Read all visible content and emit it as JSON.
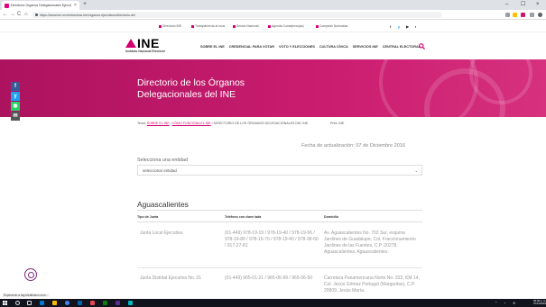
{
  "browser": {
    "tab_title": "Directorio Órganos Delegacionales Ejecut",
    "tab_close": "×",
    "new_tab": "+",
    "window_controls": [
      "–",
      "☐",
      "×"
    ],
    "back": "←",
    "forward": "→",
    "reload": "C",
    "home": "⌂",
    "url": "https://www.ine.mx/estructura-ine/organos-ejecutivos/directorio-del"
  },
  "utility_links": [
    "Directorio INE",
    "Transparencia al ecus",
    "Sesión Nacional",
    "Agenda Consejeros(as)",
    "Compartir Normativa"
  ],
  "social": [
    "f",
    "y",
    "▶",
    "◑"
  ],
  "header": {
    "logo_text": "INE",
    "logo_subtitle": "Instituto Nacional Electoral",
    "nav": [
      "SOBRE EL INE",
      "CREDENCIAL PARA VOTAR",
      "VOTO Y ELECCIONES",
      "CULTURA CÍVICA",
      "SERVICIOS INE",
      "CENTRAL ELECTORAL"
    ],
    "search_icon": "search-icon"
  },
  "hero": {
    "title_line1": "Directorio de los Órganos",
    "title_line2": "Delegacionales del INE"
  },
  "share": [
    {
      "label": "f",
      "color": "#3b5998"
    },
    {
      "label": "y",
      "color": "#1da1f2"
    },
    {
      "label": "◉",
      "color": "#25d366"
    },
    {
      "label": "✉",
      "color": "#555555"
    }
  ],
  "breadcrumb": {
    "prefix": "Tema:",
    "crumb1": "SOBRE EL INE",
    "sep1": " / ",
    "crumb2": "CÓMO FUNCIONA EL INE",
    "sep2": " / ",
    "current": "DIRECTORIO DE LOS ÓRGANOS DELEGACIONALES DEL INE",
    "print": "Print: INE"
  },
  "update_text": "Fecha de actualización: 07 de Diciembre 2016",
  "select": {
    "label": "Selecciona una entidad",
    "value": "seleccionar entidad",
    "chevron": "⌄"
  },
  "entity": "Aguascalientes",
  "table": {
    "headers": [
      "Tipo de Junta",
      "Teléfono con clave lada",
      "Domicilio"
    ],
    "rows": [
      {
        "type": "Junta Local Ejecutiva",
        "phone": "(01-449) 978-19-19 / 978-19-40 / 978-19-56 / 978-19-86 / 978-16-70 / 978-19-40 / 978-38-60 / 917-27-81",
        "address": "Av. Aguascalientes No. 702 Sur, esquina Jardines de Guadalupe, Col. Fraccionamiento Jardines de las Fuentes, C.P. 20278, Aguascalientes, Aguascalientes."
      },
      {
        "type": "Junta Distrital Ejecutiva No. 01",
        "phone": "(01-449) 965-01-21 / 965-06-99 / 965-06-50",
        "address": "Carretera Panamericana Norte No. 323, KM 14, Col. Jesús Gómez Portugal (Margaritas), C.P. 20909, Jesús María,"
      }
    ]
  },
  "statusbar": "Esperando a tag.tribalfusion.com...",
  "taskbar": {
    "time": "05:06 p. m.",
    "date": "07/12/2016",
    "apps": [
      "#0078d7",
      "#ffb900",
      "#4285f4",
      "#0063b1",
      "#e74856",
      "#107c10",
      "#5c2d91",
      "#00b7c3"
    ]
  }
}
